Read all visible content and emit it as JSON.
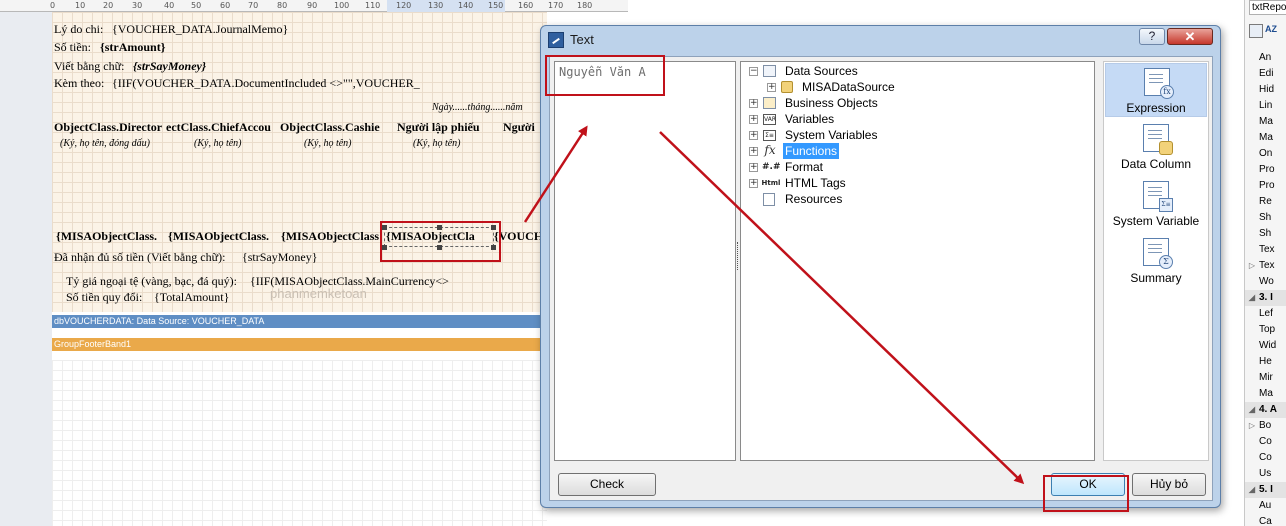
{
  "ruler": {
    "ticks": [
      "0",
      "10",
      "20",
      "30",
      "40",
      "50",
      "60",
      "70",
      "80",
      "90",
      "100",
      "110",
      "120",
      "130",
      "140",
      "150",
      "160",
      "170",
      "180"
    ]
  },
  "report": {
    "reason_label": "Lý do chi:",
    "reason_value": "{VOUCHER_DATA.JournalMemo}",
    "amount_label": "Số tiền:",
    "amount_value": "{strAmount}",
    "amount_words_label": "Viết bằng chữ:",
    "amount_words_value": "{strSayMoney}",
    "attach_label": "Kèm theo:",
    "attach_value": "{IIF(VOUCHER_DATA.DocumentIncluded <>\"\",VOUCHER_",
    "date_line": "Ngày......tháng......năm",
    "sig_headers": [
      "ObjectClass.Director",
      "ectClass.ChiefAccou",
      "ObjectClass.Cashie",
      "Người lập phiếu",
      "Người"
    ],
    "sig_hints": [
      "(Ký, họ tên, đóng dấu)",
      "(Ký, họ tên)",
      "(Ký, họ tên)",
      "(Ký, họ tên)"
    ],
    "sig_fields": [
      "{MISAObjectClass.",
      "{MISAObjectClass.",
      "{MISAObjectClass",
      "{MISAObjectCla",
      "{VOUCH"
    ],
    "received_label": "Đã nhận đủ số tiền (Viết bằng chữ):",
    "received_value": "{strSayMoney}",
    "rate_label": "Tỷ giá ngoại tệ (vàng, bạc, đá quý):",
    "rate_value": "{IIF(MISAObjectClass.MainCurrency<>",
    "converted_label": "Số tiền quy đổi:",
    "converted_value": "{TotalAmount}",
    "watermark": "phanmemketoan",
    "band_data": "dbVOUCHERDATA: Data Source: VOUCHER_DATA",
    "band_footer": "GroupFooterBand1"
  },
  "properties": {
    "header": "txtRepo",
    "rows": [
      {
        "label": "An",
        "expander": ""
      },
      {
        "label": "Edi",
        "expander": ""
      },
      {
        "label": "Hid",
        "expander": ""
      },
      {
        "label": "Lin",
        "expander": ""
      },
      {
        "label": "Ma",
        "expander": ""
      },
      {
        "label": "Ma",
        "expander": ""
      },
      {
        "label": "On",
        "expander": ""
      },
      {
        "label": "Pro",
        "expander": ""
      },
      {
        "label": "Pro",
        "expander": ""
      },
      {
        "label": "Re",
        "expander": ""
      },
      {
        "label": "Sh",
        "expander": ""
      },
      {
        "label": "Sh",
        "expander": ""
      },
      {
        "label": "Tex",
        "expander": ""
      },
      {
        "label": "Tex",
        "expander": "▷"
      },
      {
        "label": "Wo",
        "expander": ""
      },
      {
        "label": "3. I",
        "expander": "◢"
      },
      {
        "label": "Lef",
        "expander": ""
      },
      {
        "label": "Top",
        "expander": ""
      },
      {
        "label": "Wid",
        "expander": ""
      },
      {
        "label": "He",
        "expander": ""
      },
      {
        "label": "Mir",
        "expander": ""
      },
      {
        "label": "Ma",
        "expander": ""
      },
      {
        "label": "4. A",
        "expander": "◢"
      },
      {
        "label": "Bo",
        "expander": "▷"
      },
      {
        "label": "Co",
        "expander": ""
      },
      {
        "label": "Co",
        "expander": ""
      },
      {
        "label": "Us",
        "expander": ""
      },
      {
        "label": "5. I",
        "expander": "◢"
      },
      {
        "label": "Au",
        "expander": ""
      },
      {
        "label": "Ca",
        "expander": ""
      }
    ]
  },
  "dialog": {
    "title": "Text",
    "help_label": "?",
    "close_label": "✕",
    "text_value": "Nguyễn Văn A",
    "tree": {
      "data_sources": "Data Sources",
      "misa_source": "MISADataSource",
      "business_objects": "Business Objects",
      "variables": "Variables",
      "system_variables": "System Variables",
      "functions": "Functions",
      "format": "Format",
      "html_tags": "HTML Tags",
      "resources": "Resources"
    },
    "side_buttons": {
      "expression": "Expression",
      "data_column": "Data Column",
      "system_variable": "System Variable",
      "summary": "Summary"
    },
    "check_label": "Check",
    "ok_label": "OK",
    "cancel_label": "Hủy bỏ"
  },
  "colors": {
    "annotation_red": "#c0111a",
    "selection_blue": "#3399ff",
    "band_data": "#5f8ec4",
    "band_footer": "#eaa94a"
  }
}
